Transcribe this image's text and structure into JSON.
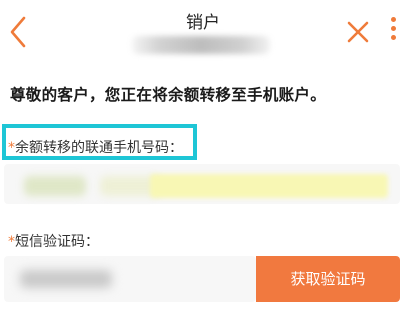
{
  "header": {
    "title": "销户",
    "back_icon": "chevron-left-icon",
    "close_icon": "close-icon",
    "more_icon": "more-vertical-icon",
    "accent_color": "#ef7b3a"
  },
  "intro_text": "尊敬的客户，您正在将余额转移至手机账户。",
  "phone_field": {
    "required_mark": "*",
    "label": "余额转移的联通手机号码：",
    "highlight_color": "#1ec6d6"
  },
  "code_field": {
    "required_mark": "*",
    "label": "短信验证码："
  },
  "send_code_button": {
    "label": "获取验证码",
    "color": "#f1793f"
  }
}
